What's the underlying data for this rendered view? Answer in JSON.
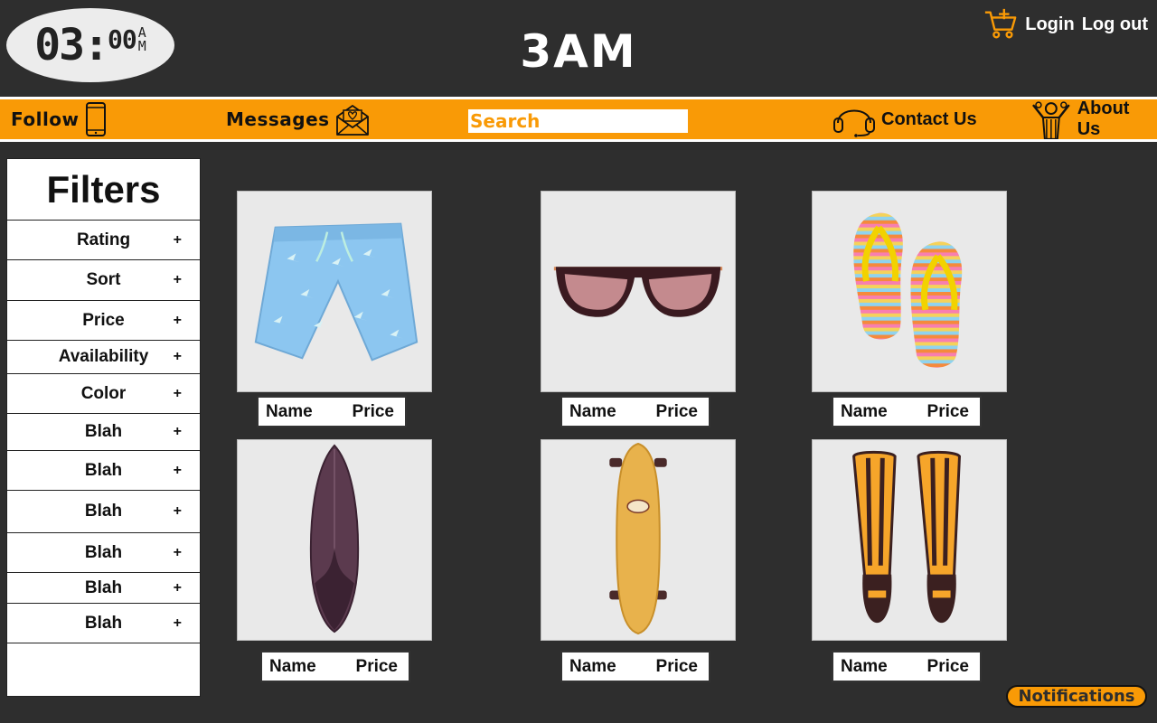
{
  "clock": {
    "hours": "03:",
    "minutes": "00",
    "am_top": "A",
    "am_bottom": "M"
  },
  "brand": "3AM",
  "auth": {
    "login": "Login",
    "logout": "Log out"
  },
  "nav": {
    "follow": "Follow",
    "messages": "Messages",
    "search_placeholder": "Search",
    "contact": "Contact Us",
    "about": "About Us"
  },
  "filters": {
    "title": "Filters",
    "items": [
      {
        "label": "Rating",
        "icon": "+"
      },
      {
        "label": "Sort",
        "icon": "+"
      },
      {
        "label": "Price",
        "icon": "+"
      },
      {
        "label": "Availability",
        "icon": "+"
      },
      {
        "label": "Color",
        "icon": "+"
      },
      {
        "label": "Blah",
        "icon": "+"
      },
      {
        "label": "Blah",
        "icon": "+"
      },
      {
        "label": "Blah",
        "icon": "+"
      },
      {
        "label": "Blah",
        "icon": "+"
      },
      {
        "label": "Blah",
        "icon": "+"
      },
      {
        "label": "Blah",
        "icon": "+"
      }
    ]
  },
  "products": [
    {
      "image": "swim-shorts",
      "name": "Name",
      "price": "Price"
    },
    {
      "image": "sunglasses",
      "name": "Name",
      "price": "Price"
    },
    {
      "image": "flip-flops",
      "name": "Name",
      "price": "Price"
    },
    {
      "image": "surfboard",
      "name": "Name",
      "price": "Price"
    },
    {
      "image": "skateboard",
      "name": "Name",
      "price": "Price"
    },
    {
      "image": "swim-fins",
      "name": "Name",
      "price": "Price"
    }
  ],
  "notifications": "Notifications",
  "colors": {
    "background": "#2e2e2e",
    "accent": "#f99a06",
    "panel": "#ffffff"
  }
}
